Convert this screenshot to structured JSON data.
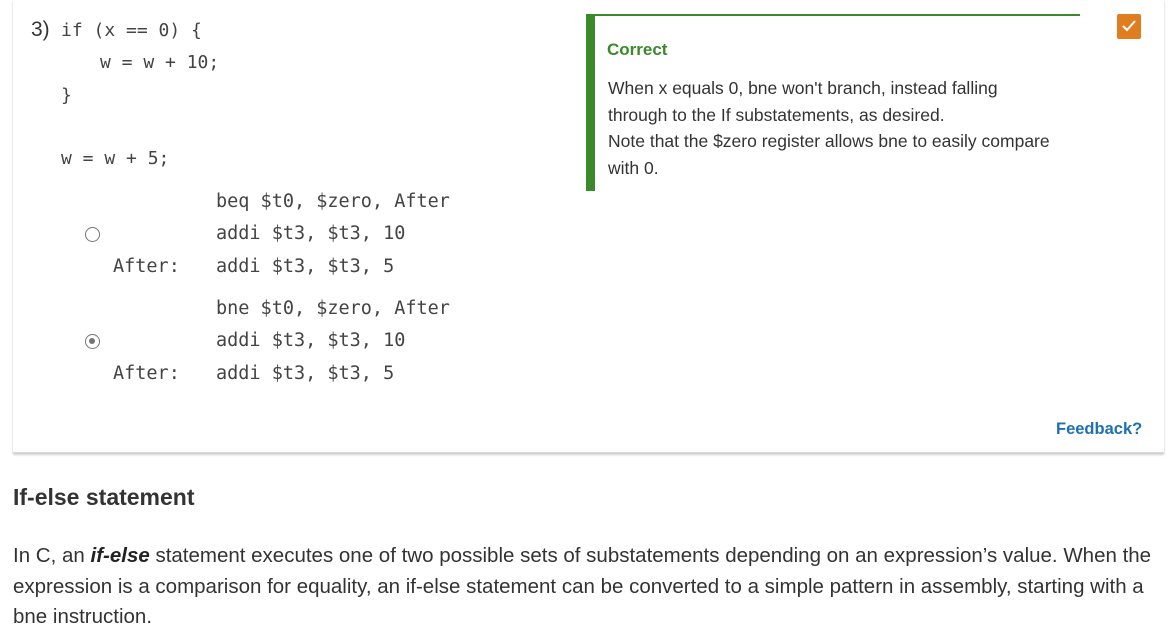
{
  "question": {
    "number": "3)",
    "code": {
      "line1": "if (x == 0) {",
      "line2": "w = w + 10;",
      "line3": "}",
      "line4": "w = w + 5;"
    }
  },
  "options": [
    {
      "selected": false,
      "line1": "beq $t0, $zero, After",
      "line2": "addi $t3, $t3, 10",
      "label": "After:",
      "line3": "addi $t3, $t3, 5"
    },
    {
      "selected": true,
      "line1": "bne $t0, $zero, After",
      "line2": "addi $t3, $t3, 10",
      "label": "After:",
      "line3": "addi $t3, $t3, 5"
    }
  ],
  "feedback": {
    "status": "Correct",
    "line1": "When x equals 0, bne won't branch, instead falling",
    "line2": "through to the If substatements, as desired.",
    "line3": "Note that the $zero register allows bne to easily compare",
    "line4": "with 0.",
    "status_color": "#3b8a2a",
    "badge_color": "#e07d20",
    "link": "Feedback?"
  },
  "section": {
    "heading": "If-else statement",
    "para_before": "In C, an ",
    "para_term": "if-else",
    "para_after": " statement executes one of two possible sets of substatements depending on an expression’s value. When the expression is a comparison for equality, an if-else statement can be converted to a simple pattern in assembly, starting with a bne instruction."
  }
}
